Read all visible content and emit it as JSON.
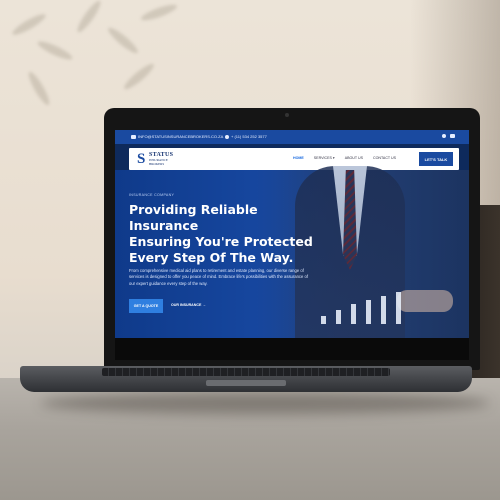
{
  "site": {
    "topbar": {
      "email": "INFO@STATUSINSURANCEBROKERS.CO.ZA",
      "phone": "+ (11) 534 252 3577"
    },
    "logo": {
      "mark": "S",
      "name": "STATUS",
      "subtitle_line1": "INSURANCE",
      "subtitle_line2": "BROKERS"
    },
    "nav": {
      "items": [
        "HOME",
        "SERVICES ▾",
        "ABOUT US",
        "CONTACT US"
      ],
      "active": "HOME",
      "cta": "LET'S TALK"
    },
    "hero": {
      "eyebrow": "INSURANCE COMPANY",
      "headline_line1": "Providing Reliable Insurance",
      "headline_line2": "Ensuring You're Protected",
      "headline_line3": "Every Step Of The Way.",
      "body": "From comprehensive medical aid plans to retirement and estate planning, our diverse range of services is designed to offer you peace of mind. Embrace life's possibilities with the assurance of our expert guidance every step of the way.",
      "primary_button": "GET A QUOTE",
      "secondary_button": "OUR INSURANCE →"
    }
  },
  "colors": {
    "brand_blue": "#1a4aa0",
    "button_blue": "#2f7fe0",
    "hero_bg": "#1748a1"
  }
}
